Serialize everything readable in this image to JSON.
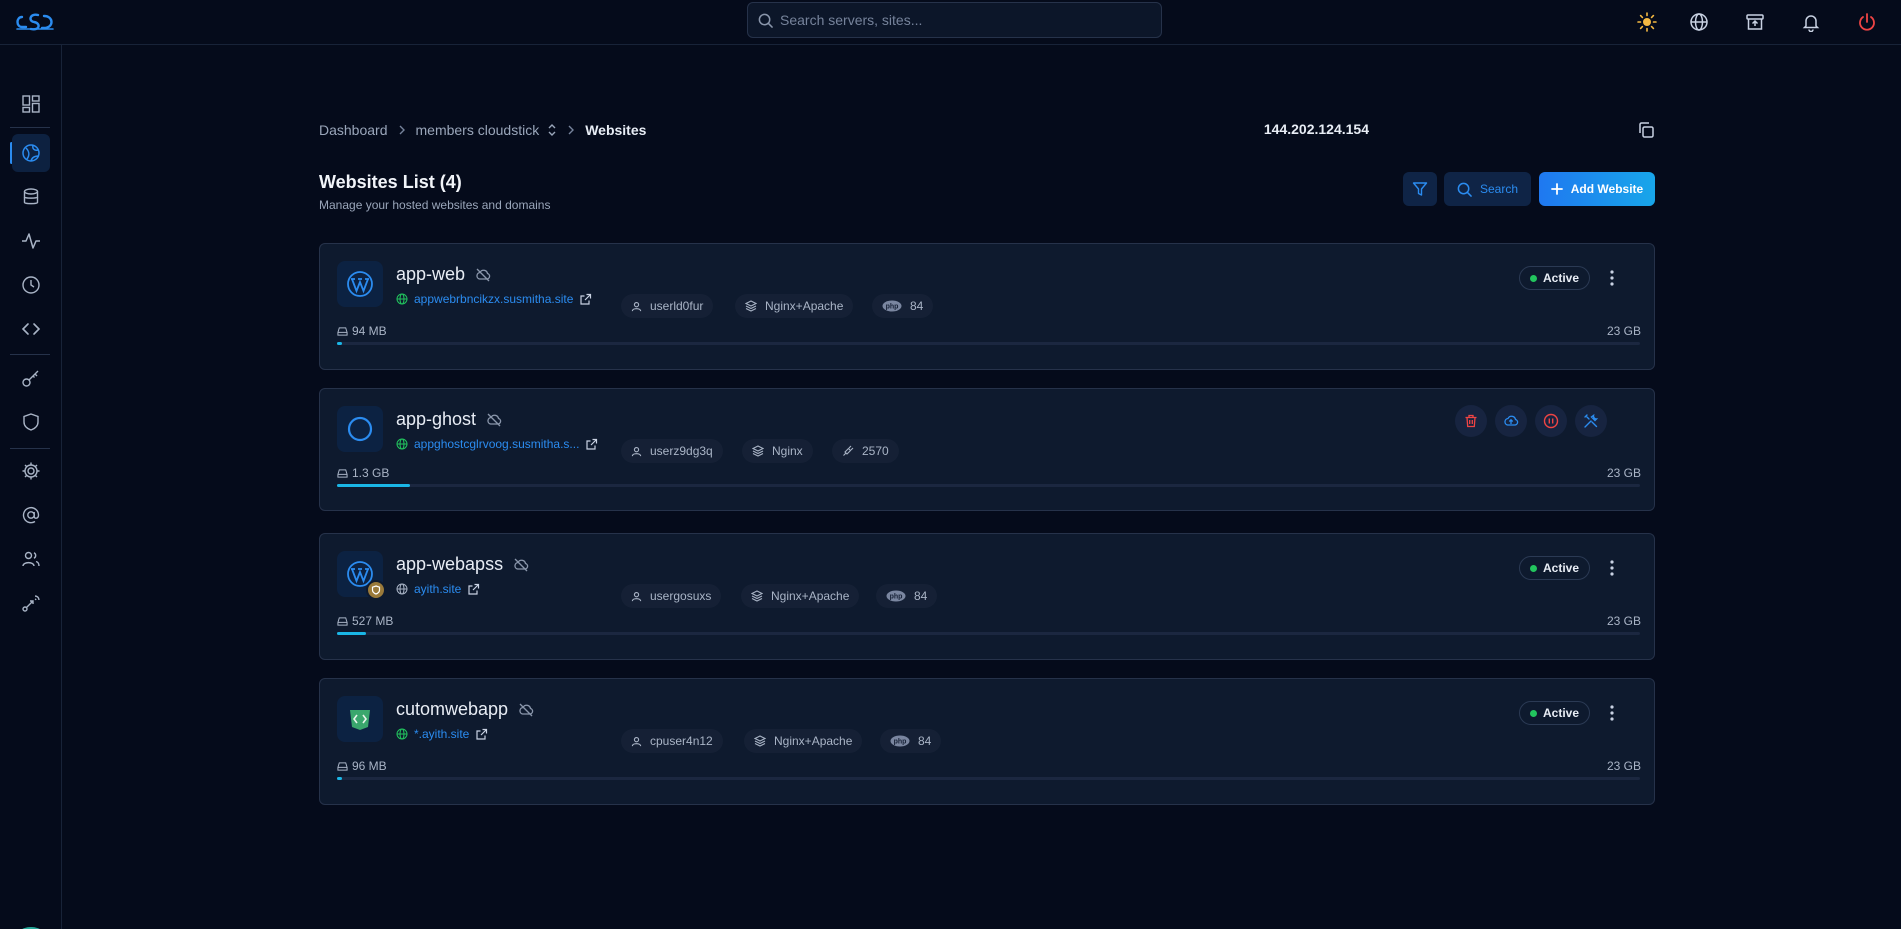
{
  "search": {
    "placeholder": "Search servers, sites..."
  },
  "breadcrumb": {
    "dashboard": "Dashboard",
    "server": "members cloudstick",
    "current": "Websites"
  },
  "server_ip": "144.202.124.154",
  "page": {
    "title": "Websites List (4)",
    "subtitle": "Manage your hosted websites and domains"
  },
  "actions": {
    "search_label": "Search",
    "add_label": "Add Website"
  },
  "colors": {
    "accent": "#2b8cf0",
    "active": "#22c55e",
    "progress": "#1ab6e6",
    "danger": "#ef4444"
  },
  "websites": [
    {
      "name": "app-web",
      "url": "appwebrbncikzx.susmitha.site",
      "icon": "wordpress-icon",
      "user": "userld0fur",
      "stack": "Nginx+Apache",
      "runtime_icon": "php-icon",
      "runtime": "84",
      "size": "94 MB",
      "quota": "23 GB",
      "usage_fraction": 0.004,
      "status": "Active"
    },
    {
      "name": "app-ghost",
      "url": "appghostcglrvoog.susmitha.s...",
      "icon": "ghost-icon",
      "user": "userz9dg3q",
      "stack": "Nginx",
      "runtime_icon": "port-icon",
      "runtime": "2570",
      "size": "1.3 GB",
      "quota": "23 GB",
      "usage_fraction": 0.056,
      "status": ""
    },
    {
      "name": "app-webapss",
      "url": "ayith.site",
      "icon": "wordpress-icon",
      "user": "usergosuxs",
      "stack": "Nginx+Apache",
      "runtime_icon": "php-icon",
      "runtime": "84",
      "size": "527 MB",
      "quota": "23 GB",
      "usage_fraction": 0.022,
      "status": "Active"
    },
    {
      "name": "cutomwebapp",
      "url": "*.ayith.site",
      "icon": "custom-app-icon",
      "user": "cpuser4n12",
      "stack": "Nginx+Apache",
      "runtime_icon": "php-icon",
      "runtime": "84",
      "size": "96 MB",
      "quota": "23 GB",
      "usage_fraction": 0.004,
      "status": "Active"
    }
  ]
}
